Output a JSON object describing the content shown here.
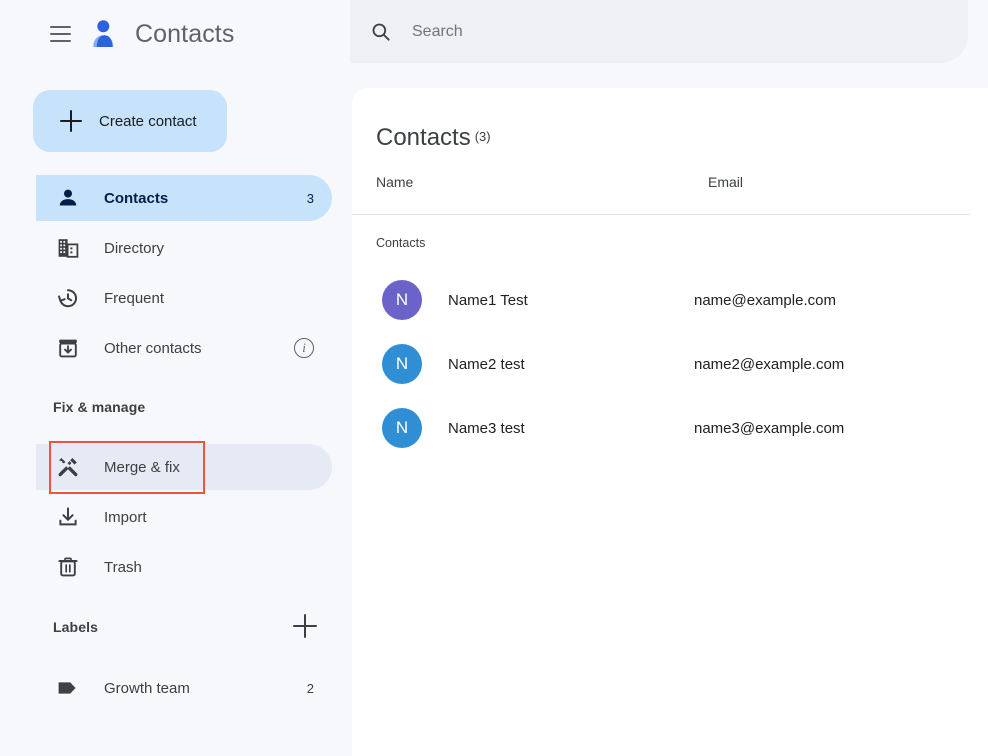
{
  "app": {
    "title": "Contacts",
    "logo_icon": "contacts-person-logo",
    "menu_icon": "hamburger-menu-icon"
  },
  "sidebar": {
    "create_button": {
      "label": "Create contact",
      "icon": "plus-icon"
    },
    "nav_items": [
      {
        "label": "Contacts",
        "icon": "person-icon",
        "count": "3",
        "selected": true,
        "hovered": false,
        "trailing": ""
      },
      {
        "label": "Directory",
        "icon": "building-icon",
        "count": "",
        "selected": false,
        "hovered": false,
        "trailing": ""
      },
      {
        "label": "Frequent",
        "icon": "history-clock-icon",
        "count": "",
        "selected": false,
        "hovered": false,
        "trailing": ""
      },
      {
        "label": "Other contacts",
        "icon": "archive-down-icon",
        "count": "",
        "selected": false,
        "hovered": false,
        "trailing": "info-icon"
      }
    ],
    "fix_manage": {
      "heading": "Fix & manage",
      "items": [
        {
          "label": "Merge & fix",
          "icon": "handyman-tools-icon",
          "count": "",
          "selected": false,
          "hovered": true,
          "trailing": ""
        },
        {
          "label": "Import",
          "icon": "download-tray-icon",
          "count": "",
          "selected": false,
          "hovered": false,
          "trailing": ""
        },
        {
          "label": "Trash",
          "icon": "trash-bin-icon",
          "count": "",
          "selected": false,
          "hovered": false,
          "trailing": ""
        }
      ]
    },
    "labels": {
      "heading": "Labels",
      "add_icon": "plus-icon",
      "items": [
        {
          "label": "Growth team",
          "icon": "label-tag-icon",
          "count": "2",
          "selected": false,
          "hovered": false,
          "trailing": ""
        }
      ]
    }
  },
  "search": {
    "placeholder": "Search",
    "value": "",
    "icon": "search-icon"
  },
  "main": {
    "title": "Contacts",
    "count": "(3)",
    "columns": {
      "name": "Name",
      "email": "Email"
    },
    "group_label": "Contacts",
    "rows": [
      {
        "initial": "N",
        "avatar_color": "#6b63c9",
        "name": "Name1 Test",
        "email": "name@example.com"
      },
      {
        "initial": "N",
        "avatar_color": "#2f8ed4",
        "name": "Name2 test",
        "email": "name2@example.com"
      },
      {
        "initial": "N",
        "avatar_color": "#2f8ed4",
        "name": "Name3 test",
        "email": "name3@example.com"
      }
    ]
  },
  "annotation": {
    "target": "Merge & fix",
    "color": "#f4523b"
  },
  "colors": {
    "accent_blue": "#1a73e8",
    "selected_pill": "#c7e3fb",
    "hover_pill": "#e6eaf4",
    "sidebar_bg": "#f7f8fc",
    "searchbar_bg": "#eff0f3"
  }
}
